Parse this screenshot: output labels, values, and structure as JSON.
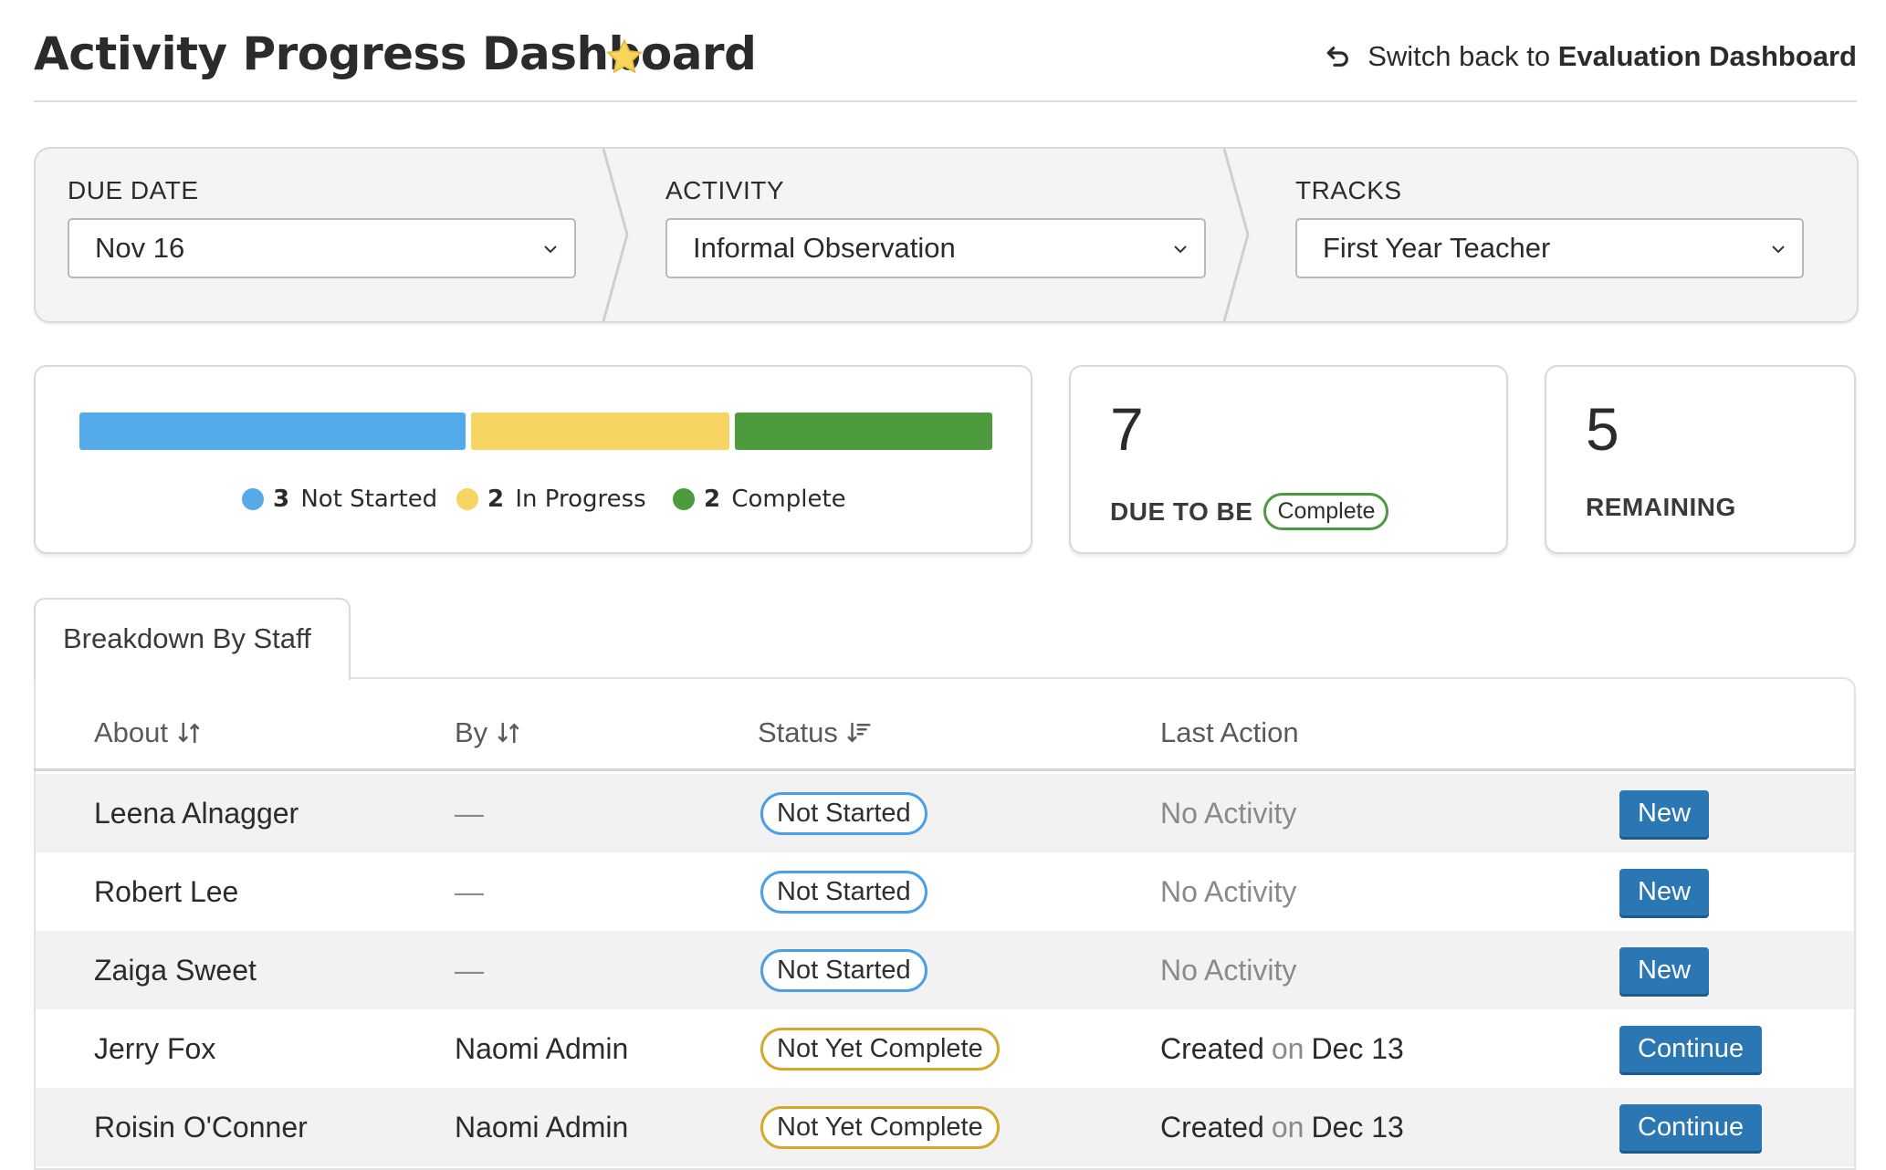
{
  "header": {
    "title": "Activity Progress Dashboard",
    "switch_prefix": "Switch back to",
    "switch_target": "Evaluation Dashboard"
  },
  "filters": {
    "due_date": {
      "label": "DUE DATE",
      "value": "Nov 16"
    },
    "activity": {
      "label": "ACTIVITY",
      "value": "Informal Observation"
    },
    "tracks": {
      "label": "TRACKS",
      "value": "First Year Teacher"
    }
  },
  "progress": {
    "items": [
      {
        "count": "3",
        "label": "Not Started",
        "color": "#55aaea",
        "value": 3
      },
      {
        "count": "2",
        "label": "In Progress",
        "color": "#f5d462",
        "value": 2
      },
      {
        "count": "2",
        "label": "Complete",
        "color": "#4d9b3d",
        "value": 2
      }
    ]
  },
  "due_card": {
    "number": "7",
    "label": "DUE TO BE",
    "pill": "Complete"
  },
  "remaining_card": {
    "number": "5",
    "label": "REMAINING"
  },
  "tab": {
    "label": "Breakdown By Staff"
  },
  "table": {
    "columns": {
      "about": "About",
      "by": "By",
      "status": "Status",
      "last_action": "Last Action"
    },
    "rows": [
      {
        "about": "Leena Alnagger",
        "by": "—",
        "status": "Not Started",
        "last_action": "No Activity",
        "button": "New"
      },
      {
        "about": "Robert Lee",
        "by": "—",
        "status": "Not Started",
        "last_action": "No Activity",
        "button": "New"
      },
      {
        "about": "Zaiga Sweet",
        "by": "—",
        "status": "Not Started",
        "last_action": "No Activity",
        "button": "New"
      },
      {
        "about": "Jerry Fox",
        "by": "Naomi Admin",
        "status": "Not Yet Complete",
        "action_verb": "Created",
        "action_on": "on",
        "action_date": "Dec 13",
        "button": "Continue"
      },
      {
        "about": "Roisin O'Conner",
        "by": "Naomi Admin",
        "status": "Not Yet Complete",
        "action_verb": "Created",
        "action_on": "on",
        "action_date": "Dec 13",
        "button": "Continue"
      }
    ]
  },
  "colors": {
    "button": "#2b77b4",
    "not_started_border": "#4a9fe6",
    "in_progress_border": "#d4a82a",
    "complete_border": "#4c9a3f"
  }
}
